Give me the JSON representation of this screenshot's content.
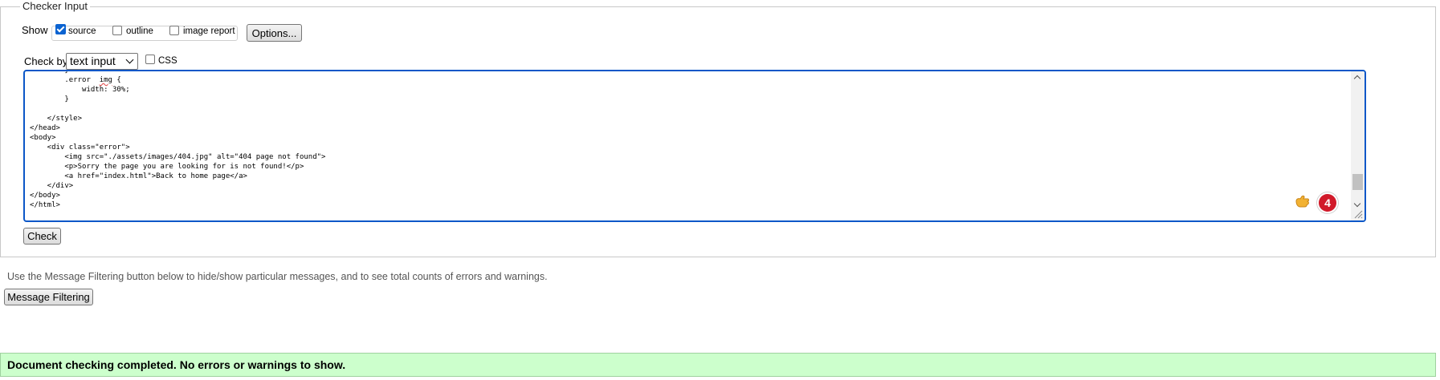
{
  "checker": {
    "legend": "Checker Input",
    "show_label": "Show",
    "show_options": [
      {
        "label": "source",
        "checked": true
      },
      {
        "label": "outline",
        "checked": false
      },
      {
        "label": "image report",
        "checked": false
      }
    ],
    "options_button": "Options...",
    "check_by_label": "Check by",
    "check_by_value": "text input",
    "css_label": "CSS",
    "css_checked": false,
    "code_lines": [
      "        }",
      "        .error  img {",
      "            width: 30%;",
      "        }",
      "",
      "    </style>",
      "</head>",
      "<body>",
      "    <div class=\"error\">",
      "        <img src=\"./assets/images/404.jpg\" alt=\"404 page not found\">",
      "        <p>Sorry the page you are looking for is not found!</p>",
      "        <a href=\"index.html\">Back to home page</a>",
      "    </div>",
      "</body>",
      "</html>"
    ],
    "extension_badge_count": "4",
    "check_button": "Check"
  },
  "hint_text": "Use the Message Filtering button below to hide/show particular messages, and to see total counts of errors and warnings.",
  "message_filtering_button": "Message Filtering",
  "status_message": "Document checking completed. No errors or warnings to show.",
  "colors": {
    "status_bg": "#ccffcc",
    "editor_border": "#0b57c8",
    "badge": "#d11a2a",
    "checkbox_checked": "#0b63d1"
  },
  "icons": {
    "extension_hand": "hand-icon",
    "badge": "error-count-badge",
    "resize": "resize-grip-icon"
  }
}
